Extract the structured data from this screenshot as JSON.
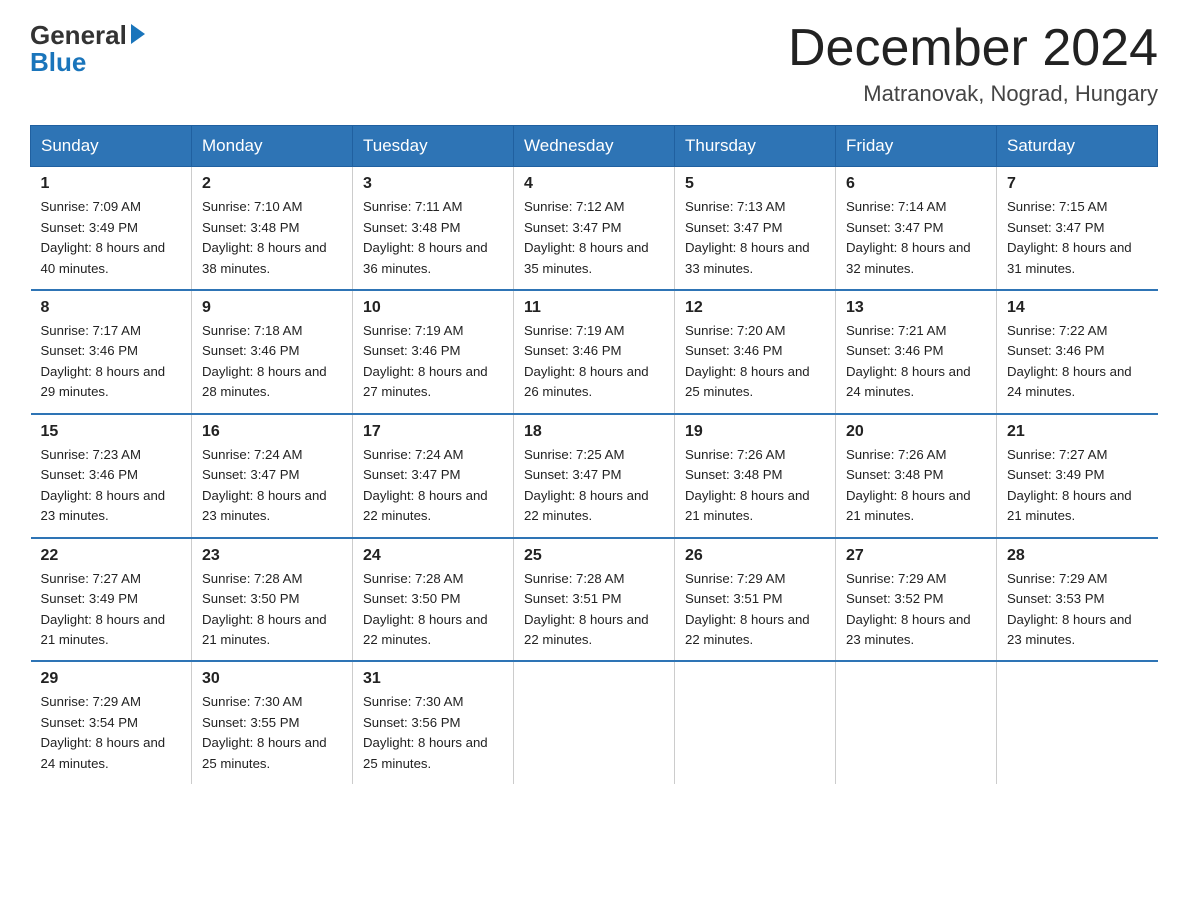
{
  "header": {
    "logo_general": "General",
    "logo_blue": "Blue",
    "month_title": "December 2024",
    "location": "Matranovak, Nograd, Hungary"
  },
  "days_of_week": [
    "Sunday",
    "Monday",
    "Tuesday",
    "Wednesday",
    "Thursday",
    "Friday",
    "Saturday"
  ],
  "weeks": [
    [
      {
        "num": "1",
        "sunrise": "7:09 AM",
        "sunset": "3:49 PM",
        "daylight": "8 hours and 40 minutes."
      },
      {
        "num": "2",
        "sunrise": "7:10 AM",
        "sunset": "3:48 PM",
        "daylight": "8 hours and 38 minutes."
      },
      {
        "num": "3",
        "sunrise": "7:11 AM",
        "sunset": "3:48 PM",
        "daylight": "8 hours and 36 minutes."
      },
      {
        "num": "4",
        "sunrise": "7:12 AM",
        "sunset": "3:47 PM",
        "daylight": "8 hours and 35 minutes."
      },
      {
        "num": "5",
        "sunrise": "7:13 AM",
        "sunset": "3:47 PM",
        "daylight": "8 hours and 33 minutes."
      },
      {
        "num": "6",
        "sunrise": "7:14 AM",
        "sunset": "3:47 PM",
        "daylight": "8 hours and 32 minutes."
      },
      {
        "num": "7",
        "sunrise": "7:15 AM",
        "sunset": "3:47 PM",
        "daylight": "8 hours and 31 minutes."
      }
    ],
    [
      {
        "num": "8",
        "sunrise": "7:17 AM",
        "sunset": "3:46 PM",
        "daylight": "8 hours and 29 minutes."
      },
      {
        "num": "9",
        "sunrise": "7:18 AM",
        "sunset": "3:46 PM",
        "daylight": "8 hours and 28 minutes."
      },
      {
        "num": "10",
        "sunrise": "7:19 AM",
        "sunset": "3:46 PM",
        "daylight": "8 hours and 27 minutes."
      },
      {
        "num": "11",
        "sunrise": "7:19 AM",
        "sunset": "3:46 PM",
        "daylight": "8 hours and 26 minutes."
      },
      {
        "num": "12",
        "sunrise": "7:20 AM",
        "sunset": "3:46 PM",
        "daylight": "8 hours and 25 minutes."
      },
      {
        "num": "13",
        "sunrise": "7:21 AM",
        "sunset": "3:46 PM",
        "daylight": "8 hours and 24 minutes."
      },
      {
        "num": "14",
        "sunrise": "7:22 AM",
        "sunset": "3:46 PM",
        "daylight": "8 hours and 24 minutes."
      }
    ],
    [
      {
        "num": "15",
        "sunrise": "7:23 AM",
        "sunset": "3:46 PM",
        "daylight": "8 hours and 23 minutes."
      },
      {
        "num": "16",
        "sunrise": "7:24 AM",
        "sunset": "3:47 PM",
        "daylight": "8 hours and 23 minutes."
      },
      {
        "num": "17",
        "sunrise": "7:24 AM",
        "sunset": "3:47 PM",
        "daylight": "8 hours and 22 minutes."
      },
      {
        "num": "18",
        "sunrise": "7:25 AM",
        "sunset": "3:47 PM",
        "daylight": "8 hours and 22 minutes."
      },
      {
        "num": "19",
        "sunrise": "7:26 AM",
        "sunset": "3:48 PM",
        "daylight": "8 hours and 21 minutes."
      },
      {
        "num": "20",
        "sunrise": "7:26 AM",
        "sunset": "3:48 PM",
        "daylight": "8 hours and 21 minutes."
      },
      {
        "num": "21",
        "sunrise": "7:27 AM",
        "sunset": "3:49 PM",
        "daylight": "8 hours and 21 minutes."
      }
    ],
    [
      {
        "num": "22",
        "sunrise": "7:27 AM",
        "sunset": "3:49 PM",
        "daylight": "8 hours and 21 minutes."
      },
      {
        "num": "23",
        "sunrise": "7:28 AM",
        "sunset": "3:50 PM",
        "daylight": "8 hours and 21 minutes."
      },
      {
        "num": "24",
        "sunrise": "7:28 AM",
        "sunset": "3:50 PM",
        "daylight": "8 hours and 22 minutes."
      },
      {
        "num": "25",
        "sunrise": "7:28 AM",
        "sunset": "3:51 PM",
        "daylight": "8 hours and 22 minutes."
      },
      {
        "num": "26",
        "sunrise": "7:29 AM",
        "sunset": "3:51 PM",
        "daylight": "8 hours and 22 minutes."
      },
      {
        "num": "27",
        "sunrise": "7:29 AM",
        "sunset": "3:52 PM",
        "daylight": "8 hours and 23 minutes."
      },
      {
        "num": "28",
        "sunrise": "7:29 AM",
        "sunset": "3:53 PM",
        "daylight": "8 hours and 23 minutes."
      }
    ],
    [
      {
        "num": "29",
        "sunrise": "7:29 AM",
        "sunset": "3:54 PM",
        "daylight": "8 hours and 24 minutes."
      },
      {
        "num": "30",
        "sunrise": "7:30 AM",
        "sunset": "3:55 PM",
        "daylight": "8 hours and 25 minutes."
      },
      {
        "num": "31",
        "sunrise": "7:30 AM",
        "sunset": "3:56 PM",
        "daylight": "8 hours and 25 minutes."
      },
      null,
      null,
      null,
      null
    ]
  ]
}
